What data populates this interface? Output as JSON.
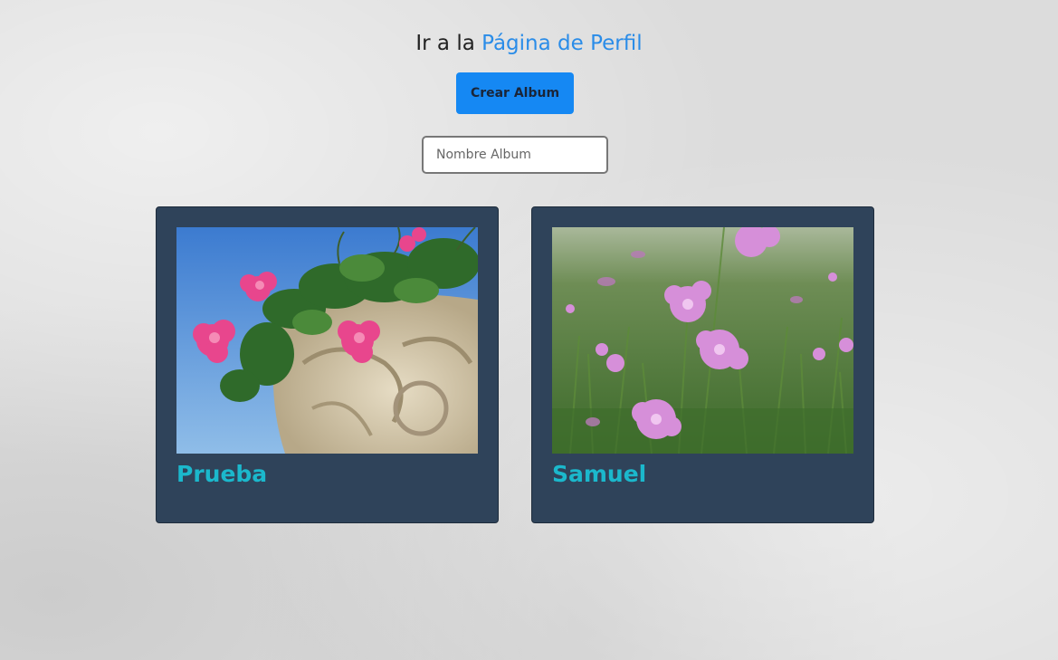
{
  "header": {
    "prefix": "Ir a la",
    "link_label": "Página de Perfil"
  },
  "create_button_label": "Crear Album",
  "album_name_input": {
    "placeholder": "Nombre Album",
    "value": ""
  },
  "albums": [
    {
      "title": "Prueba",
      "image": "pink-geraniums-stone-urn-photo"
    },
    {
      "title": "Samuel",
      "image": "purple-wildflowers-meadow-photo"
    }
  ],
  "colors": {
    "link": "#2a8ce8",
    "button": "#1588f3",
    "card_bg": "#2f435a",
    "album_title": "#1bb8cc"
  }
}
